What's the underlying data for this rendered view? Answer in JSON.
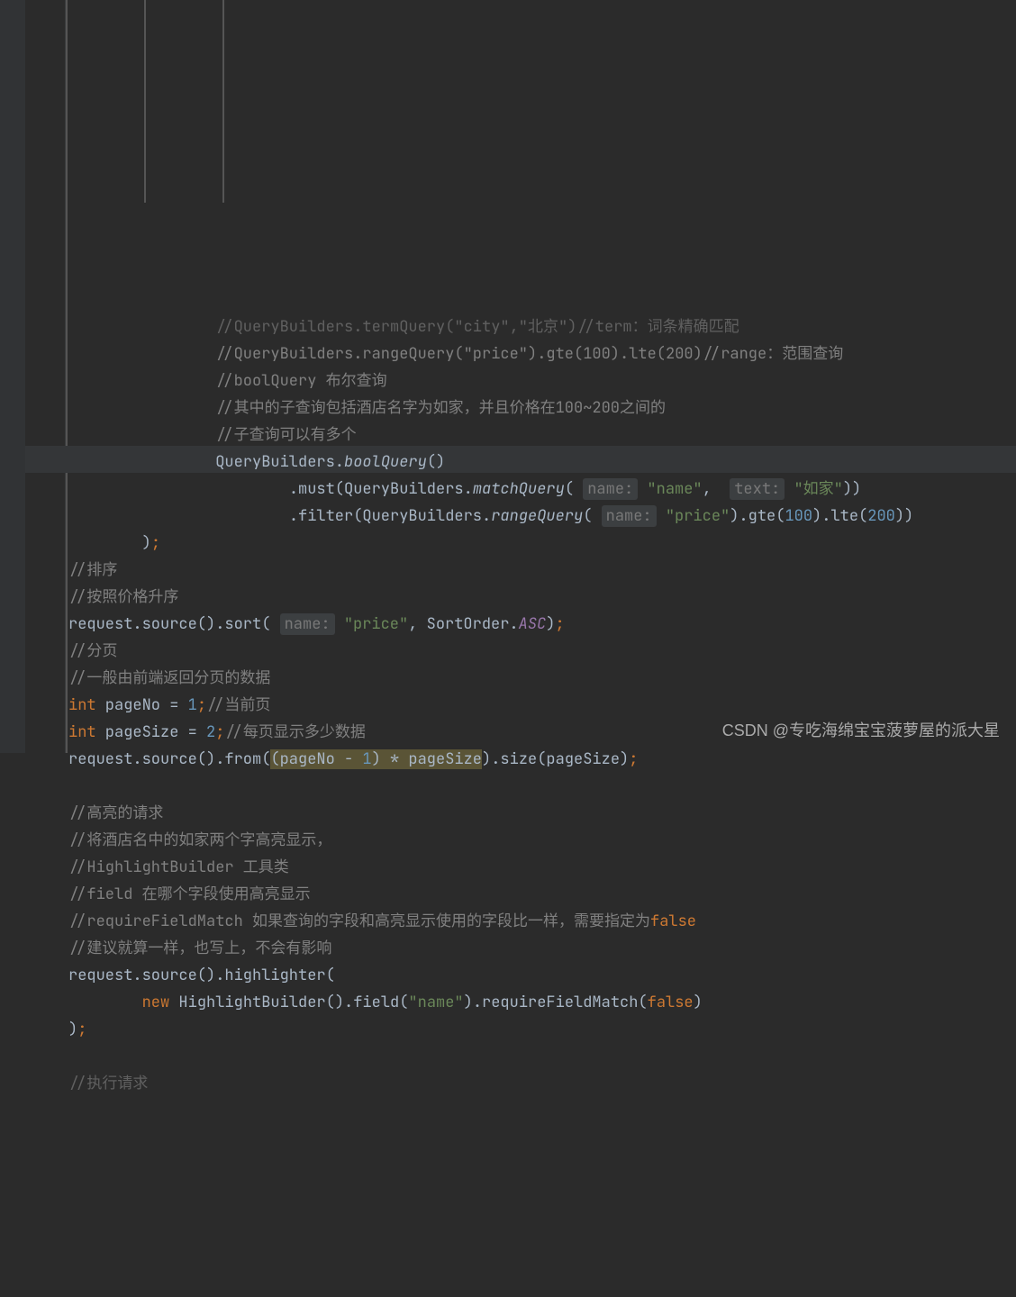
{
  "lines": {
    "l1a": "//QueryBuilders.termQuery(\"city\",\"北京\")//term：词条精确匹配",
    "l2a": "//QueryBuilders.rangeQuery(\"price\").gte(100).lte(200)//range：范围查询",
    "l3a": "//boolQuery 布尔查询",
    "l4a": "//其中的子查询包括酒店名字为如家，并且价格在100~200之间的",
    "l5a": "//子查询可以有多个",
    "l6_qb": "QueryBuilders.",
    "l6_bool": "boolQuery",
    "l6_paren": "()",
    "l7_pre": ".must(QueryBuilders.",
    "l7_match": "matchQuery",
    "l7_p1": "name:",
    "l7_s1": "\"name\"",
    "l7_p2": "text:",
    "l7_s2": "\"如家\"",
    "l7_end": "))",
    "l8_pre": ".filter(QueryBuilders.",
    "l8_range": "rangeQuery",
    "l8_p1": "name:",
    "l8_s1": "\"price\"",
    "l8_mid1": ").gte(",
    "l8_n1": "100",
    "l8_mid2": ").lte(",
    "l8_n2": "200",
    "l8_end": "))",
    "l9_close": ")",
    "l9_semi": ";",
    "l10": "//排序",
    "l11": "//按照价格升序",
    "l12_a": "request.source().sort(",
    "l12_p": "name:",
    "l12_s": "\"price\"",
    "l12_b": " SortOrder.",
    "l12_asc": "ASC",
    "l12_c": ")",
    "l12_semi": ";",
    "l13": "//分页",
    "l14": "//一般由前端返回分页的数据",
    "l15_int": "int",
    "l15_a": " pageNo = ",
    "l15_n": "1",
    "l15_semi": ";",
    "l15_c": "//当前页",
    "l16_int": "int",
    "l16_a": " pageSize = ",
    "l16_n": "2",
    "l16_semi": ";",
    "l16_c": "//每页显示多少数据",
    "l17_a": "request.source().from(",
    "l17_sel1": "(pageNo - ",
    "l17_sel_n": "1",
    "l17_sel2": ") * pageSize",
    "l17_b": ").size(pageSize)",
    "l17_semi": ";",
    "l19": "//高亮的请求",
    "l20": "//将酒店名中的如家两个字高亮显示，",
    "l21": "//HighlightBuilder 工具类",
    "l22": "//field 在哪个字段使用高亮显示",
    "l23a": "//requireFieldMatch 如果查询的字段和高亮显示使用的字段比一样，需要指定为",
    "l23b": "false",
    "l24": "//建议就算一样，也写上，不会有影响",
    "l25": "request.source().highlighter(",
    "l26_new": "new",
    "l26_a": " HighlightBuilder().field(",
    "l26_s": "\"name\"",
    "l26_b": ").requireFieldMatch(",
    "l26_false": "false",
    "l26_c": ")",
    "l27_a": ")",
    "l27_semi": ";",
    "l29": "//执行请求"
  },
  "watermark": "CSDN @专吃海绵宝宝菠萝屋的派大星"
}
